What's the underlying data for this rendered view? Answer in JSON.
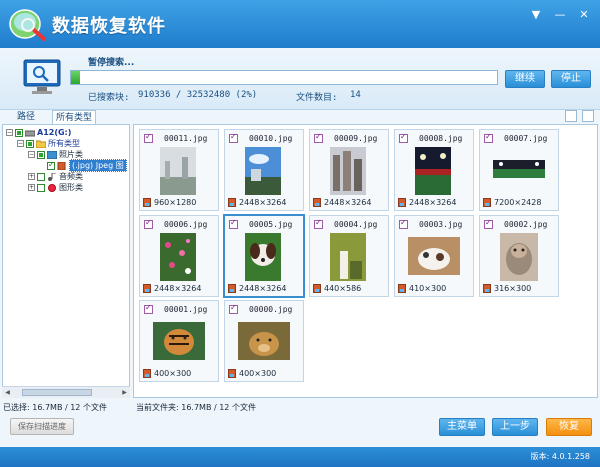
{
  "window": {
    "title": "数据恢复软件",
    "controls": [
      "▼",
      "—",
      "✕"
    ]
  },
  "scan": {
    "status": "暂停搜索...",
    "progress_percent": 2,
    "searched_label": "已搜索块:",
    "searched_value": "910336 / 32532480 (2%)",
    "files_label": "文件数目:",
    "files_value": "14",
    "continue_label": "继续",
    "stop_label": "停止"
  },
  "tabs": [
    {
      "label": "路径",
      "active": false
    },
    {
      "label": "所有类型",
      "active": true
    }
  ],
  "tree": {
    "drive": "A12(G:)",
    "all_types": "所有类型",
    "photos": "照片类",
    "jpeg": "(.jpg) Jpeg 图",
    "audio": "音频类",
    "graphics": "图形类"
  },
  "files": [
    {
      "name": "00011.jpg",
      "size": "960×1280"
    },
    {
      "name": "00010.jpg",
      "size": "2448×3264"
    },
    {
      "name": "00009.jpg",
      "size": "2448×3264"
    },
    {
      "name": "00008.jpg",
      "size": "2448×3264"
    },
    {
      "name": "00007.jpg",
      "size": "7200×2428"
    },
    {
      "name": "00006.jpg",
      "size": "2448×3264"
    },
    {
      "name": "00005.jpg",
      "size": "2448×3264"
    },
    {
      "name": "00004.jpg",
      "size": "440×586"
    },
    {
      "name": "00003.jpg",
      "size": "410×300"
    },
    {
      "name": "00002.jpg",
      "size": "316×300"
    },
    {
      "name": "00001.jpg",
      "size": "400×300"
    },
    {
      "name": "00000.jpg",
      "size": "400×300"
    }
  ],
  "status": {
    "selected": "已选择: 16.7MB / 12 个文件",
    "current_folder": "当前文件夹: 16.7MB / 12 个文件"
  },
  "buttons": {
    "save_progress": "保存扫描进度",
    "main_menu": "主菜单",
    "back": "上一步",
    "recover": "恢复"
  },
  "version": "版本: 4.0.1.258",
  "colors": {
    "titlebar": "#2b88d0",
    "accent_blue": "#2a8fd7",
    "accent_orange": "#f48f10",
    "progress_green": "#2fa42f"
  }
}
